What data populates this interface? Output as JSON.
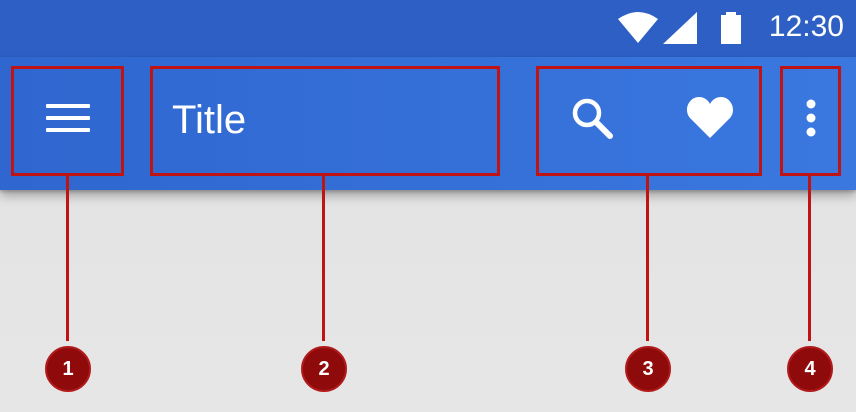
{
  "status_bar": {
    "time": "12:30",
    "icons": [
      "wifi-icon",
      "signal-icon",
      "battery-icon"
    ]
  },
  "app_bar": {
    "title": "Title",
    "nav_icon": "menu-icon",
    "action_icons": [
      "search-icon",
      "heart-icon"
    ],
    "overflow_icon": "more-vert-icon"
  },
  "callouts": [
    {
      "number": "1"
    },
    {
      "number": "2"
    },
    {
      "number": "3"
    },
    {
      "number": "4"
    }
  ],
  "colors": {
    "status_bar": "#2d5fc4",
    "app_bar": "#3570d8",
    "background": "#e0e0e0",
    "callout": "#c01414",
    "badge": "#8f0b0b"
  }
}
